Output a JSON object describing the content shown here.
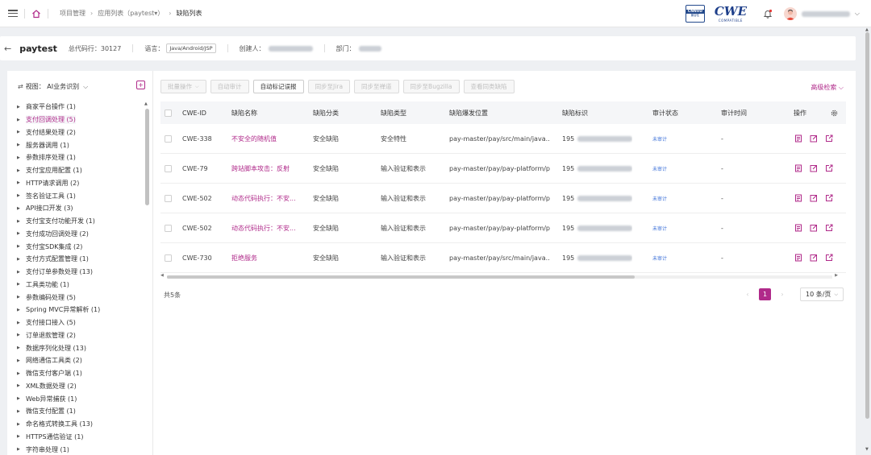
{
  "breadcrumb": {
    "items": [
      "项目管理",
      "应用列表（paytest▾）",
      "缺陷列表"
    ]
  },
  "header_right": {
    "logo1_top": "CNNVD",
    "logo1_bottom": "兼容性",
    "logo2_name": "CWE",
    "logo2_sub": "COMPATIBLE"
  },
  "project": {
    "name": "paytest",
    "lines_label": "总代码行：",
    "lines_value": "30127",
    "lang_label": "语言：",
    "lang_value": "Java/Android/JSP",
    "creator_label": "创建人：",
    "dept_label": "部门："
  },
  "sidebar": {
    "view_label": "视图： AI业务识别",
    "items": [
      {
        "label": "商家平台操作",
        "count": "(1)"
      },
      {
        "label": "支付回调处理",
        "count": "(5)",
        "selected": true
      },
      {
        "label": "支付结果处理",
        "count": "(2)"
      },
      {
        "label": "服务器调用",
        "count": "(1)"
      },
      {
        "label": "参数排序处理",
        "count": "(1)"
      },
      {
        "label": "支付宝应用配置",
        "count": "(1)"
      },
      {
        "label": "HTTP请求调用",
        "count": "(2)"
      },
      {
        "label": "签名验证工具",
        "count": "(1)"
      },
      {
        "label": "API接口开发",
        "count": "(3)"
      },
      {
        "label": "支付宝支付功能开发",
        "count": "(1)"
      },
      {
        "label": "支付成功回调处理",
        "count": "(2)"
      },
      {
        "label": "支付宝SDK集成",
        "count": "(2)"
      },
      {
        "label": "支付方式配置管理",
        "count": "(1)"
      },
      {
        "label": "支付订单参数处理",
        "count": "(13)"
      },
      {
        "label": "工具类功能",
        "count": "(1)"
      },
      {
        "label": "参数编码处理",
        "count": "(5)"
      },
      {
        "label": "Spring MVC异常解析",
        "count": "(1)"
      },
      {
        "label": "支付接口接入",
        "count": "(5)"
      },
      {
        "label": "订单退款管理",
        "count": "(2)"
      },
      {
        "label": "数据序列化处理",
        "count": "(13)"
      },
      {
        "label": "网络通信工具类",
        "count": "(2)"
      },
      {
        "label": "微信支付客户端",
        "count": "(1)"
      },
      {
        "label": "XML数据处理",
        "count": "(2)"
      },
      {
        "label": "Web异常捕获",
        "count": "(1)"
      },
      {
        "label": "微信支付配置",
        "count": "(1)"
      },
      {
        "label": "命名格式转换工具",
        "count": "(13)"
      },
      {
        "label": "HTTPS通信验证",
        "count": "(1)"
      },
      {
        "label": "字符串处理",
        "count": "(1)"
      }
    ]
  },
  "toolbar": {
    "batch": "批量操作",
    "auto_audit": "自动审计",
    "auto_mark": "自动标记误报",
    "sync_jira": "同步至Jira",
    "sync_zentao": "同步至禅道",
    "sync_bugzilla": "同步至Bugzilla",
    "view_same": "查看同类缺陷",
    "advanced": "高级检索"
  },
  "table": {
    "headers": {
      "cwe": "CWE-ID",
      "name": "缺陷名称",
      "category": "缺陷分类",
      "type": "缺陷类型",
      "location": "缺陷爆发位置",
      "mark": "缺陷标识",
      "audit_status": "审计状态",
      "audit_time": "审计时间",
      "ops": "操作"
    },
    "rows": [
      {
        "cwe": "CWE-338",
        "name": "不安全的随机值",
        "category": "安全缺陷",
        "type": "安全特性",
        "location": "pay-master/pay/src/main/java...",
        "mark": "195",
        "audit_status": "未审计",
        "audit_time": "-"
      },
      {
        "cwe": "CWE-79",
        "name": "跨站脚本攻击：反射",
        "category": "安全缺陷",
        "type": "输入验证和表示",
        "location": "pay-master/pay/pay-platform/pay-...",
        "mark": "195",
        "audit_status": "未审计",
        "audit_time": "-"
      },
      {
        "cwe": "CWE-502",
        "name": "动态代码执行：不安...",
        "category": "安全缺陷",
        "type": "输入验证和表示",
        "location": "pay-master/pay/pay-platform/pay-...",
        "mark": "195",
        "audit_status": "未审计",
        "audit_time": "-"
      },
      {
        "cwe": "CWE-502",
        "name": "动态代码执行：不安...",
        "category": "安全缺陷",
        "type": "输入验证和表示",
        "location": "pay-master/pay/pay-platform/pay-...",
        "mark": "195",
        "audit_status": "未审计",
        "audit_time": "-"
      },
      {
        "cwe": "CWE-730",
        "name": "拒绝服务",
        "category": "安全缺陷",
        "type": "输入验证和表示",
        "location": "pay-master/pay/src/main/java...",
        "mark": "195",
        "audit_status": "未审计",
        "audit_time": "-"
      }
    ]
  },
  "pagination": {
    "total": "共5条",
    "current_page": "1",
    "page_size": "10 条/页"
  },
  "colors": {
    "accent": "#b02a8a",
    "link_blue": "#3a6fd8"
  }
}
